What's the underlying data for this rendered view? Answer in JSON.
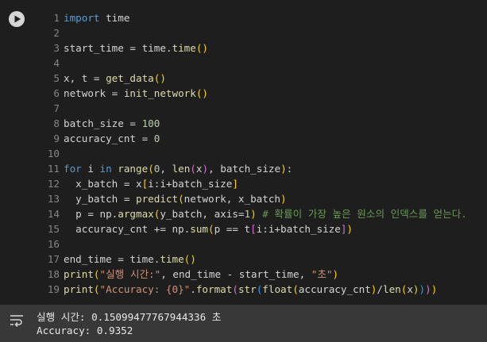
{
  "cell": {
    "run_button_icon": "play-icon",
    "lines": [
      {
        "num": "1",
        "tokens": [
          {
            "t": "import",
            "c": "kw"
          },
          {
            "t": " time",
            "c": "txt"
          }
        ]
      },
      {
        "num": "2",
        "tokens": []
      },
      {
        "num": "3",
        "tokens": [
          {
            "t": "start_time = time.",
            "c": "txt"
          },
          {
            "t": "time",
            "c": "fn"
          },
          {
            "t": "()",
            "c": "p1"
          }
        ]
      },
      {
        "num": "4",
        "tokens": []
      },
      {
        "num": "5",
        "tokens": [
          {
            "t": "x, t = ",
            "c": "txt"
          },
          {
            "t": "get_data",
            "c": "fn"
          },
          {
            "t": "()",
            "c": "p1"
          }
        ]
      },
      {
        "num": "6",
        "tokens": [
          {
            "t": "network = ",
            "c": "txt"
          },
          {
            "t": "init_network",
            "c": "fn"
          },
          {
            "t": "()",
            "c": "p1"
          }
        ]
      },
      {
        "num": "7",
        "tokens": []
      },
      {
        "num": "8",
        "tokens": [
          {
            "t": "batch_size = ",
            "c": "txt"
          },
          {
            "t": "100",
            "c": "num"
          }
        ]
      },
      {
        "num": "9",
        "tokens": [
          {
            "t": "accuracy_cnt = ",
            "c": "txt"
          },
          {
            "t": "0",
            "c": "num"
          }
        ]
      },
      {
        "num": "10",
        "tokens": []
      },
      {
        "num": "11",
        "tokens": [
          {
            "t": "for",
            "c": "kw"
          },
          {
            "t": " i ",
            "c": "txt"
          },
          {
            "t": "in",
            "c": "kw"
          },
          {
            "t": " ",
            "c": "txt"
          },
          {
            "t": "range",
            "c": "fn"
          },
          {
            "t": "(",
            "c": "p1"
          },
          {
            "t": "0",
            "c": "num"
          },
          {
            "t": ", ",
            "c": "txt"
          },
          {
            "t": "len",
            "c": "fn"
          },
          {
            "t": "(",
            "c": "p2"
          },
          {
            "t": "x",
            "c": "txt"
          },
          {
            "t": ")",
            "c": "p2"
          },
          {
            "t": ", batch_size",
            "c": "txt"
          },
          {
            "t": ")",
            "c": "p1"
          },
          {
            "t": ":",
            "c": "txt"
          }
        ]
      },
      {
        "num": "12",
        "tokens": [
          {
            "t": "  x_batch = x",
            "c": "txt"
          },
          {
            "t": "[",
            "c": "p1"
          },
          {
            "t": "i:i+batch_size",
            "c": "txt"
          },
          {
            "t": "]",
            "c": "p1"
          }
        ]
      },
      {
        "num": "13",
        "tokens": [
          {
            "t": "  y_batch = ",
            "c": "txt"
          },
          {
            "t": "predict",
            "c": "fn"
          },
          {
            "t": "(",
            "c": "p1"
          },
          {
            "t": "network, x_batch",
            "c": "txt"
          },
          {
            "t": ")",
            "c": "p1"
          }
        ]
      },
      {
        "num": "14",
        "tokens": [
          {
            "t": "  p = np.",
            "c": "txt"
          },
          {
            "t": "argmax",
            "c": "fn"
          },
          {
            "t": "(",
            "c": "p1"
          },
          {
            "t": "y_batch, axis=",
            "c": "txt"
          },
          {
            "t": "1",
            "c": "num"
          },
          {
            "t": ")",
            "c": "p1"
          },
          {
            "t": " # 확률이 가장 높은 원소의 인덱스를 얻는다.",
            "c": "cmt"
          }
        ]
      },
      {
        "num": "15",
        "tokens": [
          {
            "t": "  accuracy_cnt += np.",
            "c": "txt"
          },
          {
            "t": "sum",
            "c": "fn"
          },
          {
            "t": "(",
            "c": "p1"
          },
          {
            "t": "p == t",
            "c": "txt"
          },
          {
            "t": "[",
            "c": "p2"
          },
          {
            "t": "i:i+batch_size",
            "c": "txt"
          },
          {
            "t": "]",
            "c": "p2"
          },
          {
            "t": ")",
            "c": "p1"
          }
        ]
      },
      {
        "num": "16",
        "tokens": []
      },
      {
        "num": "17",
        "tokens": [
          {
            "t": "end_time = time.",
            "c": "txt"
          },
          {
            "t": "time",
            "c": "fn"
          },
          {
            "t": "()",
            "c": "p1"
          }
        ]
      },
      {
        "num": "18",
        "tokens": [
          {
            "t": "print",
            "c": "fn"
          },
          {
            "t": "(",
            "c": "p1"
          },
          {
            "t": "\"실행 시간:\"",
            "c": "str"
          },
          {
            "t": ", end_time - start_time, ",
            "c": "txt"
          },
          {
            "t": "\"초\"",
            "c": "str"
          },
          {
            "t": ")",
            "c": "p1"
          }
        ]
      },
      {
        "num": "19",
        "tokens": [
          {
            "t": "print",
            "c": "fn"
          },
          {
            "t": "(",
            "c": "p1"
          },
          {
            "t": "\"Accuracy: {0}\"",
            "c": "str"
          },
          {
            "t": ".",
            "c": "txt"
          },
          {
            "t": "format",
            "c": "fn"
          },
          {
            "t": "(",
            "c": "p2"
          },
          {
            "t": "str",
            "c": "fn"
          },
          {
            "t": "(",
            "c": "p3"
          },
          {
            "t": "float",
            "c": "fn"
          },
          {
            "t": "(",
            "c": "p1"
          },
          {
            "t": "accuracy_cnt",
            "c": "txt"
          },
          {
            "t": ")",
            "c": "p1"
          },
          {
            "t": "/",
            "c": "txt"
          },
          {
            "t": "len",
            "c": "fn"
          },
          {
            "t": "(",
            "c": "p1"
          },
          {
            "t": "x",
            "c": "txt"
          },
          {
            "t": ")",
            "c": "p1"
          },
          {
            "t": ")",
            "c": "p3"
          },
          {
            "t": ")",
            "c": "p2"
          },
          {
            "t": ")",
            "c": "p1"
          }
        ]
      }
    ]
  },
  "output": {
    "icon": "output-toggle-icon",
    "lines": [
      "실행 시간: 0.15099477767944336 초",
      "Accuracy: 0.9352"
    ]
  },
  "colors": {
    "background": "#1e1e1e",
    "output_background": "#383838",
    "keyword": "#569cd6",
    "function": "#dcdcaa",
    "number": "#b5cea8",
    "string": "#ce9178",
    "comment": "#6a9955"
  }
}
